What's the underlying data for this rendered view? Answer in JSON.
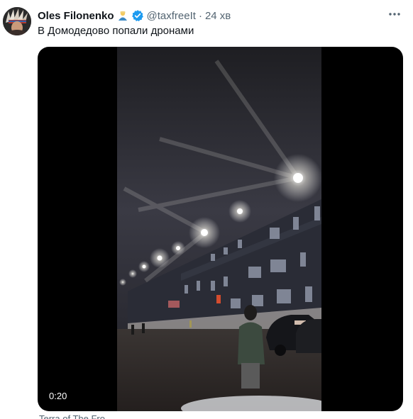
{
  "tweet": {
    "author_name": "Oles Filonenko",
    "handle": "@taxfreeIt",
    "separator": "·",
    "time": "24 хв",
    "text": "В Домодедово попали дронами",
    "video_duration": "0:20",
    "footer_text": "Terra of The Fro..."
  },
  "colors": {
    "verified_badge": "#1d9bf0",
    "text_primary": "#0f1419",
    "text_secondary": "#536471"
  },
  "icons": [
    "avatar",
    "person-emoji-icon",
    "verified-badge-icon",
    "more-options-icon"
  ]
}
